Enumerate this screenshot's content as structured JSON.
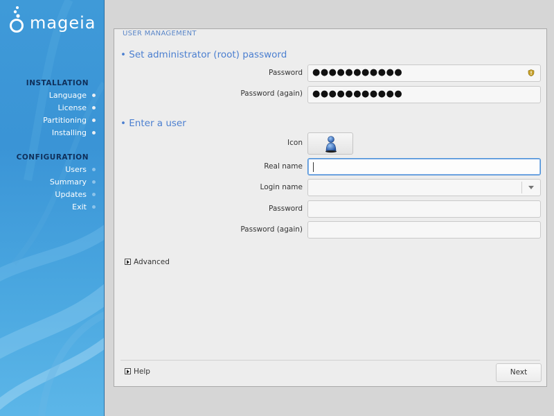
{
  "branding": {
    "logo_text": "mageia"
  },
  "sidebar": {
    "installation_heading": "INSTALLATION",
    "installation_items": [
      {
        "label": "Language"
      },
      {
        "label": "License"
      },
      {
        "label": "Partitioning"
      },
      {
        "label": "Installing"
      }
    ],
    "configuration_heading": "CONFIGURATION",
    "configuration_items": [
      {
        "label": "Users"
      },
      {
        "label": "Summary"
      },
      {
        "label": "Updates"
      },
      {
        "label": "Exit"
      }
    ]
  },
  "main": {
    "section_title": "USER MANAGEMENT",
    "root": {
      "heading": "• Set administrator (root) password",
      "password_label": "Password",
      "password_value": "●●●●●●●●●●●",
      "password_again_label": "Password (again)",
      "password_again_value": "●●●●●●●●●●●"
    },
    "user": {
      "heading": "• Enter a user",
      "icon_label": "Icon",
      "real_name_label": "Real name",
      "real_name_value": "",
      "login_name_label": "Login name",
      "login_name_value": "",
      "password_label": "Password",
      "password_value": "",
      "password_again_label": "Password (again)",
      "password_again_value": ""
    },
    "advanced_label": "Advanced",
    "help_label": "Help",
    "next_label": "Next"
  },
  "colors": {
    "sidebar_blue": "#3f9ad8",
    "heading_blue": "#4b7fd0",
    "nav_heading": "#0f2f5a",
    "focus_border": "#4a90d9"
  },
  "icons": {
    "password_strength": "shield-warning-icon",
    "user_avatar": "user-avatar-icon",
    "combo_arrow": "chevron-down-icon",
    "expander": "triangle-right-icon"
  }
}
